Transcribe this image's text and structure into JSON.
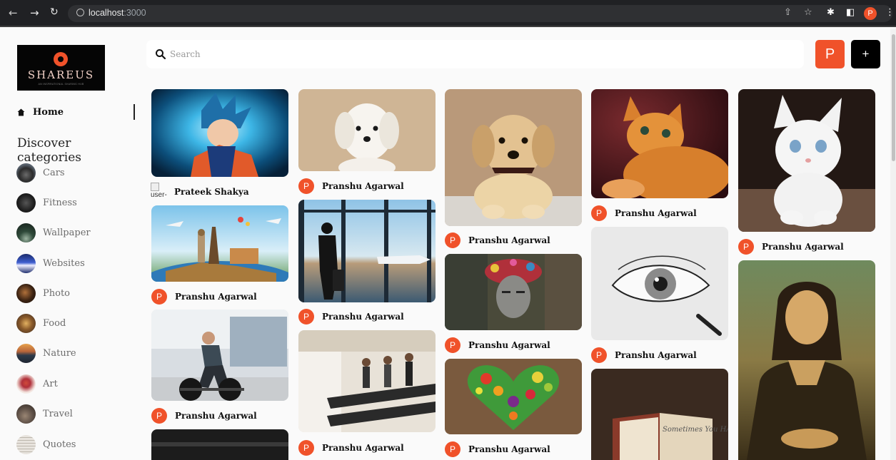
{
  "browser": {
    "url_host": "localhost",
    "url_port": ":3000",
    "profile_initial": "P"
  },
  "logo": {
    "brand": "SHAREUS",
    "tagline": "AN INSPIRATIONAL SHARING HUB"
  },
  "sidebar": {
    "home_label": "Home",
    "discover_heading": "Discover categories",
    "categories": [
      {
        "label": "Cars"
      },
      {
        "label": "Fitness"
      },
      {
        "label": "Wallpaper"
      },
      {
        "label": "Websites"
      },
      {
        "label": "Photo"
      },
      {
        "label": "Food"
      },
      {
        "label": "Nature"
      },
      {
        "label": "Art"
      },
      {
        "label": "Travel"
      },
      {
        "label": "Quotes"
      }
    ]
  },
  "search": {
    "placeholder": "Search",
    "value": ""
  },
  "header": {
    "user_initial": "P",
    "add_label": "+"
  },
  "pins": [
    {
      "author": "Prateek Shakya",
      "avatar_broken_text": "user-",
      "subject": "anime character with blue aura"
    },
    {
      "author": "Pranshu Agarwal",
      "avatar": "P",
      "subject": "world landmarks globe"
    },
    {
      "author": "Pranshu Agarwal",
      "avatar": "P",
      "subject": "man deadlifting in gym"
    },
    {
      "author": "",
      "subject": "dark desk photo"
    },
    {
      "author": "Pranshu Agarwal",
      "avatar": "P",
      "subject": "white puppy"
    },
    {
      "author": "Pranshu Agarwal",
      "avatar": "P",
      "subject": "traveler at airport window"
    },
    {
      "author": "Pranshu Agarwal",
      "avatar": "P",
      "subject": "people on treadmills"
    },
    {
      "author": "Pranshu Agarwal",
      "avatar": "P",
      "subject": "golden retriever puppy"
    },
    {
      "author": "Pranshu Agarwal",
      "avatar": "P",
      "subject": "street art portrait"
    },
    {
      "author": "Pranshu Agarwal",
      "avatar": "P",
      "subject": "vegetable heart"
    },
    {
      "author": "Pranshu Agarwal",
      "avatar": "P",
      "subject": "orange kitten"
    },
    {
      "author": "Pranshu Agarwal",
      "avatar": "P",
      "subject": "pencil eye drawing"
    },
    {
      "author": "",
      "subject": "notebook with handwriting",
      "image_text": "Sometimes You HAVE TO"
    },
    {
      "author": "Pranshu Agarwal",
      "avatar": "P",
      "subject": "white kitten"
    },
    {
      "author": "",
      "subject": "Mona Lisa painting"
    }
  ],
  "colors": {
    "accent": "#f0522a",
    "chrome": "#202124",
    "background": "#fafafa"
  }
}
